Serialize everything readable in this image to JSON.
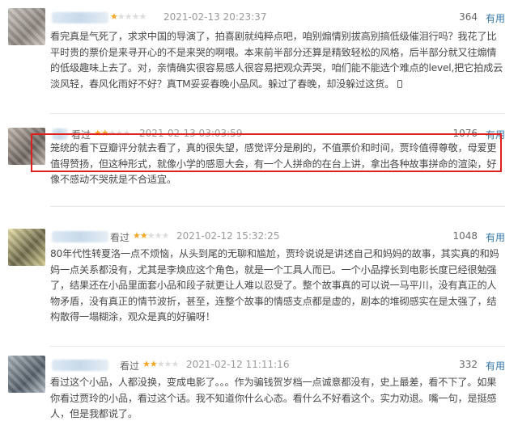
{
  "accent_color": "#e0201f",
  "star_color": "#f5a623",
  "link_color": "#3377aa",
  "reviews": [
    {
      "user": "",
      "status": "",
      "rating": 1,
      "time": "2021-02-13 20:23:37",
      "votes": "364",
      "useful_label": "有用",
      "content": "看完真是气死了，求求中国的导演了，拍喜剧就纯粹点吧，咱别煽情别拔高别搞低级催泪行吗？我花了比平时贵的票价是来寻开心的不是来哭的啊喂。本来前半部分还算是精致轻松的风格，后半部分就又往煽情的低级趣味上去了。对，亲情确实很容易感人很容易把观众弄哭，咱们能不能选个难点的level,把它拍成云淡风轻，春风化雨好不好？真TM妥妥春晚小品风。躲过了春晚，却没躲过这货。"
    },
    {
      "user": "",
      "status": "看过",
      "rating": 2,
      "time": "2021-02-13 03:03:59",
      "votes": "1076",
      "useful_label": "有用",
      "content": "笼统的看下豆瓣评分就去看了，真的很失望，感觉评分是刷的，不值票价和时间，贾玲值得尊敬，母爱更值得赞扬，但这种形式，就像小学的感恩大会，有一个人拼命的在台上讲，拿出各种故事拼命的渲染，好像不感动不哭就是不合适宜。"
    },
    {
      "user": "",
      "status": "看过",
      "rating": 2,
      "time": "2021-02-12 15:32:25",
      "votes": "1048",
      "useful_label": "有用",
      "content": "80年代性转夏洛一点不烦恼，从头到尾的无聊和尴尬，贾玲说说是讲述自己和妈妈的故事，其实真的和妈妈一点关系都没有，尤其是李焕应这个角色，就是一个工具人而已。一个小品撑长到电影长度已经很勉强了，结果还在小品里面套小品和段子就更让人难以忍受了。整个故事真的可以说一马平川，没有真正的人物矛盾，没有真正的情节波折，甚至，连整个故事的情感支点都是虚的，剧本的堆砌感实在是太强了，结构散得一塌糊涂，观众是真的好骗呀！"
    },
    {
      "user": "",
      "status": "看过",
      "rating": 2,
      "time": "2021-02-12 11:11:16",
      "votes": "332",
      "useful_label": "有用",
      "content": "看过这个小品，人都没换，变成电影了。。。作为骗钱贺岁档一点诚意都没有，史上最差，看不下了。如果你看过贾玲的小品，看过这个话。我不知道你什么心态。看什么不好看这个。实力劝退。嘴一句，是挺感人，但是我都说了。"
    }
  ]
}
